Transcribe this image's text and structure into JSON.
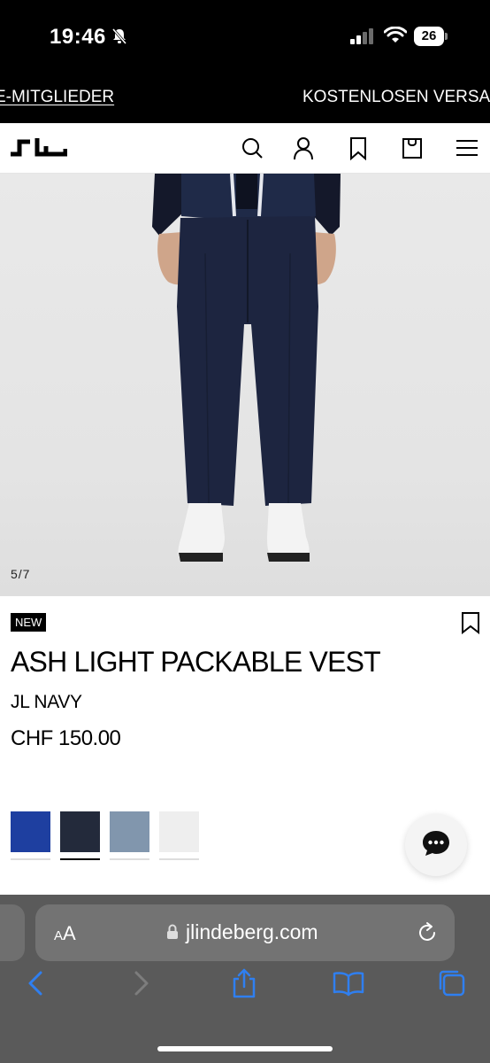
{
  "status_bar": {
    "time": "19:46",
    "battery": "26"
  },
  "promo_banner": {
    "left_text": "E-MITGLIEDER",
    "right_text": "KOSTENLOSEN VERSA"
  },
  "header": {
    "logo_icon": "jl-logo-icon",
    "icons": [
      "search-icon",
      "account-icon",
      "wishlist-icon",
      "bag-icon",
      "menu-icon"
    ]
  },
  "gallery": {
    "counter": "5/7"
  },
  "product": {
    "badge": "NEW",
    "name": "ASH LIGHT PACKABLE VEST",
    "color_name": "JL NAVY",
    "price": "CHF 150.00",
    "swatches": [
      {
        "color": "#1e3fa0",
        "selected": false
      },
      {
        "color": "#232a3b",
        "selected": true
      },
      {
        "color": "#8196ad",
        "selected": false
      },
      {
        "color": "#eeeeee",
        "selected": false
      }
    ]
  },
  "chat": {
    "icon": "chat-bubble-icon"
  },
  "browser": {
    "aa_label_small": "A",
    "aa_label_large": "A",
    "url": "jlindeberg.com",
    "toolbar_icons": [
      "back-icon",
      "forward-icon",
      "share-icon",
      "bookmarks-icon",
      "tabs-icon"
    ]
  }
}
